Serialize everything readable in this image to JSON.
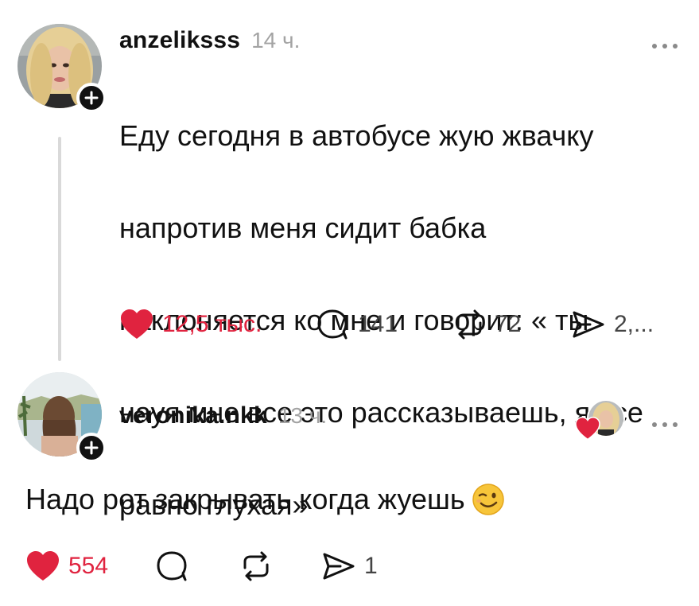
{
  "post": {
    "username": "anzeliksss",
    "timestamp": "14 ч.",
    "more_label": "•••",
    "text_lines": [
      "Еду  сегодня в автобусе жую жвачку",
      "напротив меня сидит бабка",
      "наклоняется ко мне и говорит: « ты",
      "науя мне все это рассказываешь, я все",
      "равно глухая»"
    ],
    "actions": {
      "likes": "12,5 тыс.",
      "comments": "141",
      "reposts": "72",
      "shares": "2,..."
    },
    "like_state": "liked",
    "icons": {
      "follow": "plus-icon",
      "like": "heart-icon",
      "comment": "comment-bubble-icon",
      "repost": "repost-icon",
      "share": "share-send-icon",
      "more": "more-dots-icon"
    }
  },
  "reply": {
    "username": "veronika.nkk",
    "timestamp": "13 ч.",
    "more_label": "•••",
    "text": "Надо рот закрывать когда жуешь",
    "emoji": "winking-face-emoji",
    "liked_by_author": "author-liked-icon",
    "actions": {
      "likes": "554",
      "comments": "",
      "reposts": "",
      "shares": "1"
    },
    "like_state": "liked"
  },
  "colors": {
    "like_red": "#e0233f",
    "text": "#111111",
    "muted": "#a3a3a3",
    "thread_line": "#d9d9d9"
  }
}
